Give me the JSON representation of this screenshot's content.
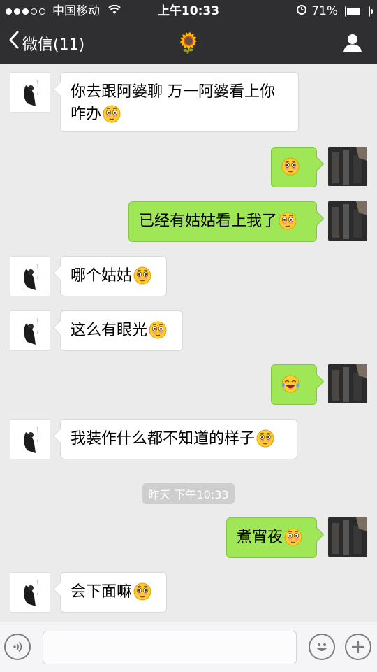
{
  "status_bar": {
    "carrier": "中国移动",
    "time": "上午10:33",
    "battery_percent": "71%",
    "battery_level": 0.71
  },
  "nav": {
    "back_label": "微信(11)",
    "title_emoji": "🌻"
  },
  "messages": [
    {
      "side": "in",
      "text": "你去跟阿婆聊 万一阿婆看上你",
      "text2": "咋办",
      "emoji": "flushed"
    },
    {
      "side": "out",
      "text": "",
      "emoji": "flushed"
    },
    {
      "side": "out",
      "text": "已经有姑姑看上我了",
      "emoji": "flushed"
    },
    {
      "side": "in",
      "text": "哪个姑姑",
      "emoji": "flushed"
    },
    {
      "side": "in",
      "text": "这么有眼光",
      "emoji": "flushed"
    },
    {
      "side": "out",
      "text": "",
      "emoji": "laughing-tears"
    },
    {
      "side": "in",
      "text": "我装作什么都不知道的样子",
      "emoji": "flushed"
    },
    {
      "side": "out",
      "text": "煮宵夜",
      "emoji": "flushed"
    },
    {
      "side": "in",
      "text": "会下面嘛",
      "emoji": "flushed"
    }
  ],
  "timestamp": "昨天 下午10:33",
  "input_bar": {
    "voice_icon": "voice-icon",
    "emoji_icon": "emoji-icon",
    "plus_icon": "plus-icon"
  },
  "colors": {
    "nav_bg": "#2f2f31",
    "chat_bg": "#ebebeb",
    "outgoing_bubble": "#9fe757",
    "incoming_bubble": "#ffffff"
  }
}
